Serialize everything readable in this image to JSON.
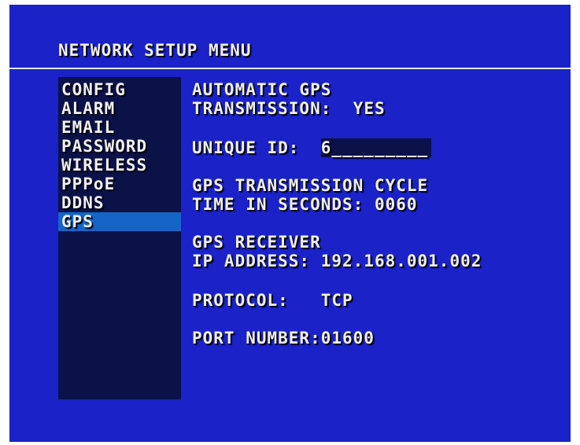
{
  "title": "NETWORK SETUP MENU",
  "sidebar": {
    "items": [
      {
        "label": "CONFIG"
      },
      {
        "label": "ALARM"
      },
      {
        "label": "EMAIL"
      },
      {
        "label": "PASSWORD"
      },
      {
        "label": "WIRELESS"
      },
      {
        "label": "PPPoE"
      },
      {
        "label": "DDNS"
      },
      {
        "label": "GPS"
      }
    ],
    "selected": "GPS"
  },
  "gps": {
    "auto_line1": "AUTOMATIC GPS",
    "auto_label": "TRANSMISSION:",
    "auto_value": "YES",
    "uid_label": "UNIQUE ID:",
    "uid_value": "6_________",
    "cycle_line1": "GPS TRANSMISSION CYCLE",
    "cycle_label": "TIME IN SECONDS:",
    "cycle_value": "0060",
    "receiver_line1": "GPS RECEIVER",
    "ip_label": "IP ADDRESS:",
    "ip_value": "192.168.001.002",
    "protocol_label": "PROTOCOL:",
    "protocol_value": "TCP",
    "port_label": "PORT NUMBER:",
    "port_value": "01600"
  },
  "colors": {
    "background": "#1a22c8",
    "sidebar": "#0b1248",
    "selected": "#1565c8",
    "text": "#f0f0f0"
  }
}
